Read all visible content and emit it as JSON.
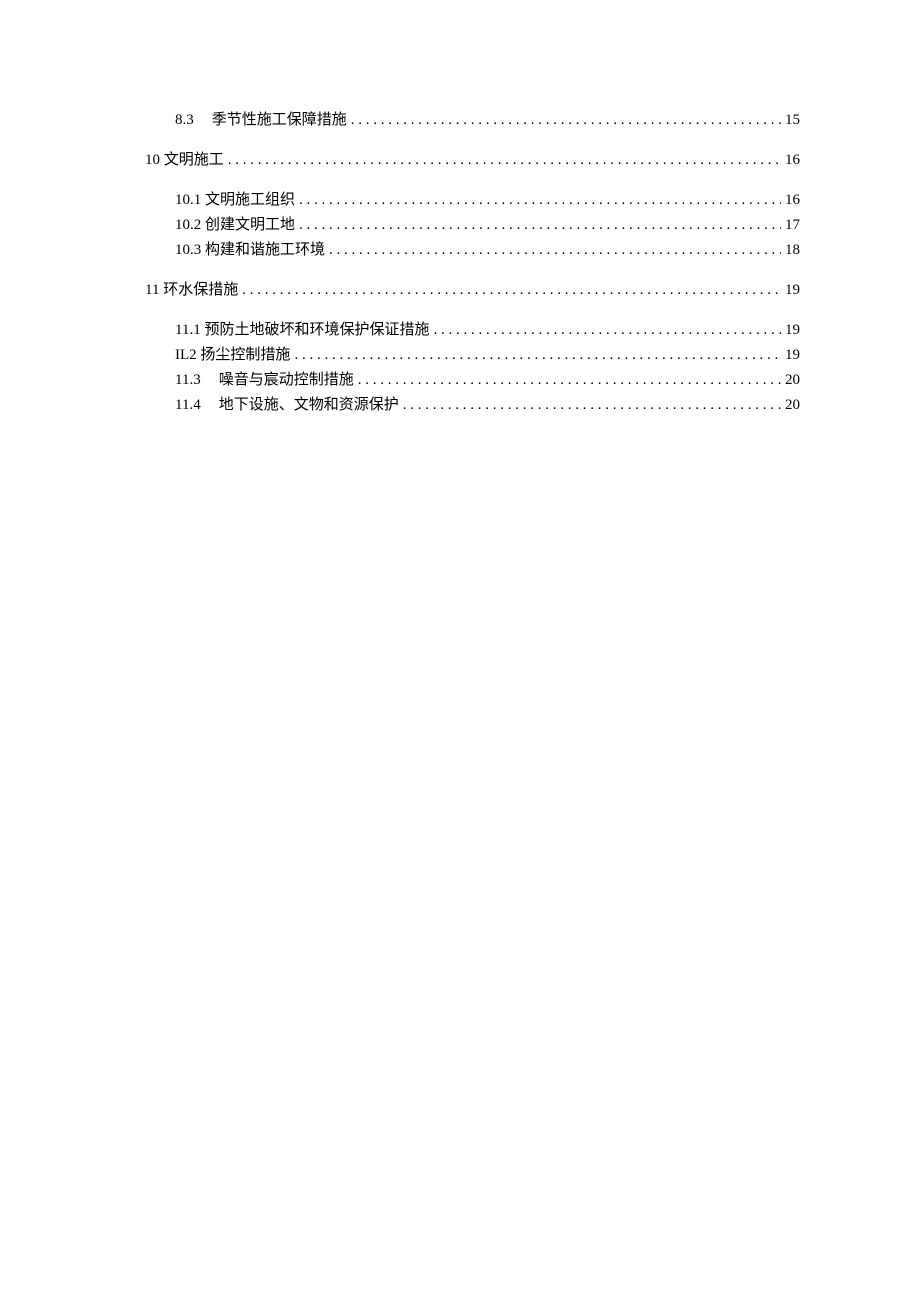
{
  "toc": {
    "group1": {
      "items": [
        {
          "num": "8.3",
          "title": "季节性施工保障措施",
          "page": "15",
          "gap": true
        }
      ]
    },
    "group2": {
      "header": {
        "num": "10",
        "title": "文明施工",
        "page": "16"
      },
      "items": [
        {
          "num": "10.1",
          "title": "文明施工组织",
          "page": "16"
        },
        {
          "num": "10.2",
          "title": "创建文明工地",
          "page": "17"
        },
        {
          "num": "10.3",
          "title": "构建和谐施工环境",
          "page": "18"
        }
      ]
    },
    "group3": {
      "header": {
        "num": "11",
        "title": "环水保措施",
        "page": "19"
      },
      "items": [
        {
          "num": "11.1",
          "title": "预防土地破坏和环境保护保证措施",
          "page": "19"
        },
        {
          "num": "IL2",
          "title": "扬尘控制措施",
          "page": "19"
        },
        {
          "num": "11.3",
          "title": "噪音与宸动控制措施",
          "page": "20",
          "gap": true
        },
        {
          "num": "11.4",
          "title": "地下设施、文物和资源保护",
          "page": "20",
          "gap": true
        }
      ]
    }
  }
}
